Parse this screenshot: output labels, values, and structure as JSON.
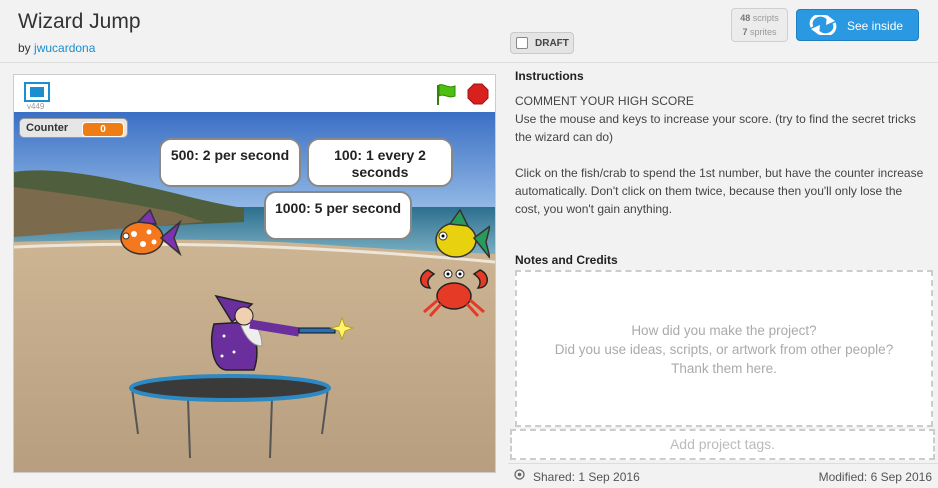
{
  "project": {
    "title": "Wizard Jump",
    "by_label": "by",
    "author": "jwucardona",
    "draft_label": "DRAFT",
    "scripts_count": "48",
    "scripts_label": "scripts",
    "sprites_count": "7",
    "sprites_label": "sprites",
    "see_inside_label": "See inside"
  },
  "player": {
    "version": "v449",
    "counter_label": "Counter",
    "counter_value": "0",
    "bubbles": {
      "b1": "500: 2 per second",
      "b2": "100: 1 every 2 seconds",
      "b3": "1000: 5 per second"
    },
    "icons": [
      "fullscreen-icon",
      "green-flag-icon",
      "stop-icon"
    ]
  },
  "info": {
    "instructions_heading": "Instructions",
    "instructions_text": "COMMENT YOUR HIGH SCORE\nUse the mouse and keys to increase your score. (try to find the secret tricks the wizard can do)\n\nClick on the fish/crab to spend the 1st number, but have the counter increase automatically. Don't click on them twice, because then you'll only lose the cost, you won't gain anything.",
    "notes_heading": "Notes and Credits",
    "notes_placeholder": "How did you make the project?\nDid you use ideas, scripts, or artwork from other people?\nThank them here.",
    "tags_placeholder": "Add project tags.",
    "shared": "Shared: 1 Sep 2016",
    "modified": "Modified: 6 Sep 2016"
  },
  "colors": {
    "accent": "#2a99e1",
    "counter": "#ee7d16",
    "link": "#1a8ecf"
  }
}
